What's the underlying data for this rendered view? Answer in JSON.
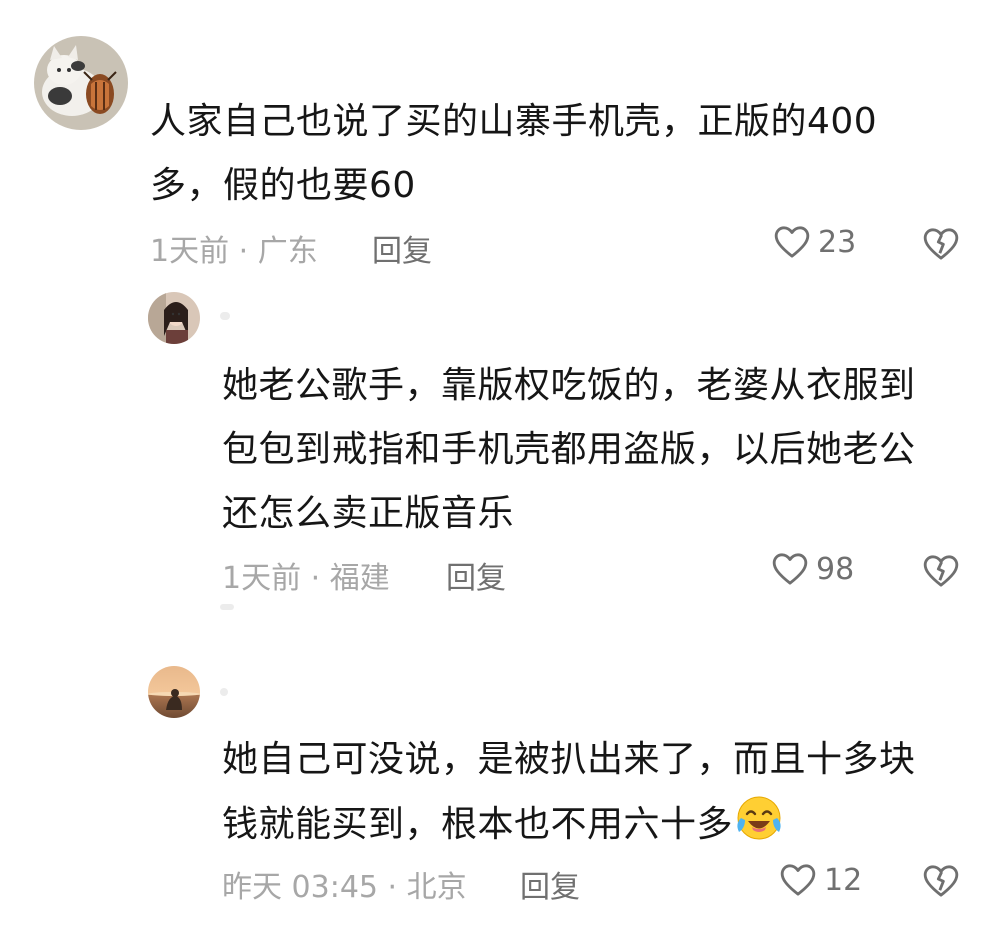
{
  "comments": [
    {
      "avatar": "cat-beetle-avatar",
      "lines": [
        "人家自己也说了买的山寨手机壳，正版的400",
        "多，假的也要60"
      ],
      "meta": "1天前 · 广东",
      "reply_label": "回复",
      "likes": "23"
    },
    {
      "avatar": "girl-avatar",
      "lines": [
        "她老公歌手，靠版权吃饭的，老婆从衣服到",
        "包包到戒指和手机壳都用盗版，以后她老公",
        "还怎么卖正版音乐"
      ],
      "meta": "1天前 · 福建",
      "reply_label": "回复",
      "likes": "98"
    },
    {
      "avatar": "sunset-avatar",
      "lines": [
        "她自己可没说，是被扒出来了，而且十多块",
        "钱就能买到，根本也不用六十多"
      ],
      "meta": "昨天 03:45 · 北京",
      "reply_label": "回复",
      "likes": "12",
      "emoji": "tears-of-joy-emoji"
    }
  ],
  "icons": {
    "like": "heart-outline-icon",
    "dislike": "broken-heart-icon"
  },
  "colors": {
    "text": "#161616",
    "meta": "#a7a7a7",
    "action": "#707070"
  }
}
